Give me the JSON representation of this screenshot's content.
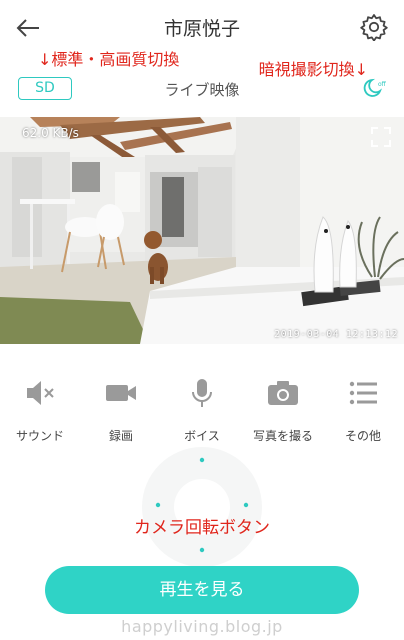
{
  "header": {
    "back_icon": "back-arrow-icon",
    "title": "市原悦子",
    "settings_icon": "gear-icon"
  },
  "annotations": {
    "quality_toggle": "↓標準・高画質切換",
    "night_vision_toggle": "暗視撮影切換↓",
    "camera_control": "カメラ回転ボタン",
    "color": "#e0261c"
  },
  "toolbar": {
    "quality_label": "SD",
    "live_label": "ライブ映像",
    "night_icon": "moon-off-icon"
  },
  "video": {
    "bitrate": "62.0 KB/s",
    "timestamp": "2019-03-04 12:13:12",
    "fullscreen_icon": "fullscreen-icon"
  },
  "controls": [
    {
      "label": "サウンド",
      "icon": "speaker-muted-icon"
    },
    {
      "label": "録画",
      "icon": "video-camera-icon"
    },
    {
      "label": "ボイス",
      "icon": "microphone-icon"
    },
    {
      "label": "写真を撮る",
      "icon": "camera-icon"
    },
    {
      "label": "その他",
      "icon": "menu-list-icon"
    }
  ],
  "play_button": {
    "label": "再生を見る"
  },
  "watermark": "happyliving.blog.jp",
  "colors": {
    "accent": "#2ec9c0",
    "play_button": "#2fd3c6",
    "icon_gray": "#9a9a9a"
  }
}
